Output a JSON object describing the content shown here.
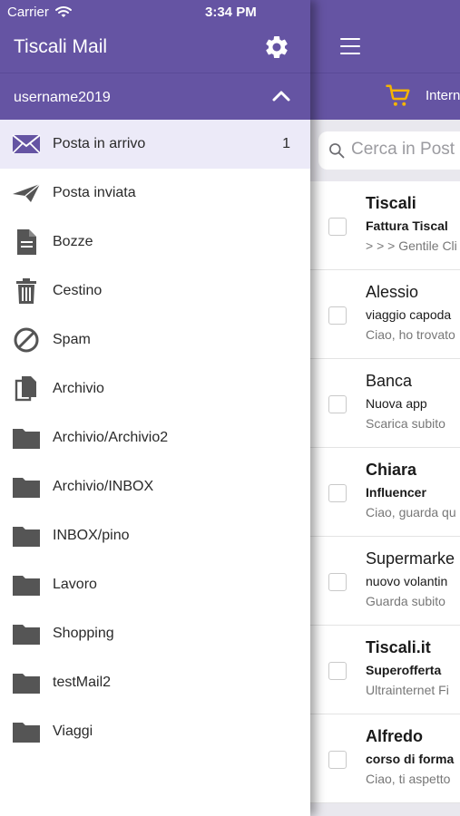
{
  "status": {
    "carrier": "Carrier",
    "time": "3:34 PM"
  },
  "drawer": {
    "title": "Tiscali Mail",
    "account": "username2019",
    "folders": [
      {
        "label": "Posta in arrivo",
        "count": "1",
        "icon": "inbox-icon"
      },
      {
        "label": "Posta inviata",
        "icon": "paper-plane-icon"
      },
      {
        "label": "Bozze",
        "icon": "document-icon"
      },
      {
        "label": "Cestino",
        "icon": "trash-icon"
      },
      {
        "label": "Spam",
        "icon": "block-icon"
      },
      {
        "label": "Archivio",
        "icon": "copy-icon"
      },
      {
        "label": "Archivio/Archivio2",
        "icon": "folder-icon"
      },
      {
        "label": "Archivio/INBOX",
        "icon": "folder-icon"
      },
      {
        "label": "INBOX/pino",
        "icon": "folder-icon"
      },
      {
        "label": "Lavoro",
        "icon": "folder-icon"
      },
      {
        "label": "Shopping",
        "icon": "folder-icon"
      },
      {
        "label": "testMail2",
        "icon": "folder-icon"
      },
      {
        "label": "Viaggi",
        "icon": "folder-icon"
      }
    ]
  },
  "main": {
    "promo_text": "Intern",
    "search_placeholder": "Cerca in Post",
    "messages": [
      {
        "sender": "Tiscali",
        "subject": "Fattura Tiscal",
        "preview": "> > > Gentile Cli",
        "unread": true
      },
      {
        "sender": "Alessio",
        "subject": "viaggio capoda",
        "preview": "Ciao, ho trovato",
        "unread": false
      },
      {
        "sender": "Banca",
        "subject": "Nuova app",
        "preview": "Scarica subito",
        "unread": false
      },
      {
        "sender": "Chiara",
        "subject": "Influencer",
        "preview": "Ciao, guarda qu",
        "unread": true
      },
      {
        "sender": "Supermarke",
        "subject": "nuovo volantin",
        "preview": "Guarda subito",
        "unread": false
      },
      {
        "sender": "Tiscali.it",
        "subject": "Superofferta",
        "preview": "Ultrainternet Fi",
        "unread": true
      },
      {
        "sender": "Alfredo",
        "subject": "corso di forma",
        "preview": "Ciao, ti aspetto",
        "unread": true
      }
    ]
  },
  "colors": {
    "brand": "#6554a3",
    "active_row": "#eceaf8",
    "cart": "#f5b400"
  }
}
